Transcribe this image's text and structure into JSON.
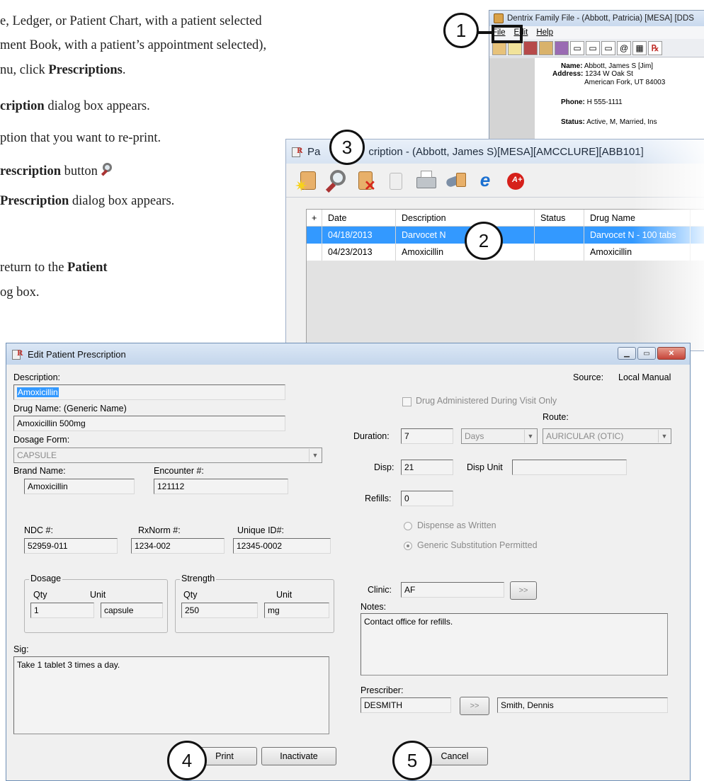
{
  "instructions": {
    "line1": "e, Ledger, or Patient Chart, with a patient selected",
    "line2": "ment Book, with a patient’s appointment selected),",
    "line3_pre": "nu, click ",
    "line3_bold": "Prescriptions",
    "line3_post": ".",
    "line4_bold": "cription",
    "line4_post": " dialog box appears.",
    "line5": "ption that you want to re-print.",
    "line6_bold": "rescription",
    "line6_post": " button ",
    "line7_bold": "Prescription",
    "line7_post": " dialog box appears.",
    "line8_pre": "return to the ",
    "line8_bold": "Patient",
    "line9": "og box."
  },
  "family_file": {
    "title": "Dentrix Family File - (Abbott, Patricia) [MESA] [DDS",
    "menu": [
      "File",
      "Edit",
      "Help"
    ],
    "name_label": "Name:",
    "name_value": "Abbott, James S [Jim]",
    "address_label": "Address:",
    "address_line1": "1234 W Oak St",
    "address_line2": "American Fork, UT  84003",
    "phone_label": "Phone:",
    "phone_value": "H 555-1111",
    "status_label": "Status:",
    "status_value": "Active, M, Married, Ins"
  },
  "patient_prescription": {
    "title_pre": "Pa",
    "title_post": "cription - (Abbott, James S)[MESA][AMCCLURE][ABB101]",
    "columns": [
      "+",
      "Date",
      "Description",
      "Status",
      "Drug Name"
    ],
    "rows": [
      {
        "date": "04/18/2013",
        "description": "Darvocet N",
        "status": "",
        "drug": "Darvocet N - 100 tabs"
      },
      {
        "date": "04/23/2013",
        "description": "Amoxicillin",
        "status": "",
        "drug": "Amoxicillin"
      }
    ]
  },
  "edit_prescription": {
    "title": "Edit Patient Prescription",
    "description_label": "Description:",
    "description_value": "Amoxicillin",
    "source_label": "Source:",
    "source_value": "Local Manual",
    "drug_admin_label": "Drug Administered During Visit Only",
    "drug_name_label": "Drug Name: (Generic Name)",
    "drug_name_value": "Amoxicillin 500mg",
    "route_label": "Route:",
    "duration_label": "Duration:",
    "duration_value": "7",
    "duration_unit": "Days",
    "route_value": "AURICULAR (OTIC)",
    "dosage_form_label": "Dosage Form:",
    "dosage_form_value": "CAPSULE",
    "disp_label": "Disp:",
    "disp_value": "21",
    "disp_unit_label": "Disp Unit",
    "disp_unit_value": "",
    "brand_label": "Brand Name:",
    "brand_value": "Amoxicillin",
    "encounter_label": "Encounter #:",
    "encounter_value": "121112",
    "refills_label": "Refills:",
    "refills_value": "0",
    "dispense_written_label": "Dispense as Written",
    "generic_sub_label": "Generic Substitution Permitted",
    "ndc_label": "NDC #:",
    "ndc_value": "52959-011",
    "rxnorm_label": "RxNorm #:",
    "rxnorm_value": "1234-002",
    "unique_label": "Unique ID#:",
    "unique_value": "12345-0002",
    "dosage_group": "Dosage",
    "strength_group": "Strength",
    "qty_label": "Qty",
    "unit_label": "Unit",
    "dosage_qty": "1",
    "dosage_unit": "capsule",
    "strength_qty": "250",
    "strength_unit": "mg",
    "clinic_label": "Clinic:",
    "clinic_value": "AF",
    "browse_label": ">>",
    "notes_label": "Notes:",
    "notes_value": "Contact office for refills.",
    "sig_label": "Sig:",
    "sig_value": "Take 1 tablet 3 times a day.",
    "prescriber_label": "Prescriber:",
    "prescriber_id": "DESMITH",
    "prescriber_name": "Smith, Dennis",
    "print_button": "Print",
    "inactivate_button": "Inactivate",
    "cancel_button": "Cancel"
  },
  "callouts": [
    "1",
    "2",
    "3",
    "4",
    "5"
  ]
}
